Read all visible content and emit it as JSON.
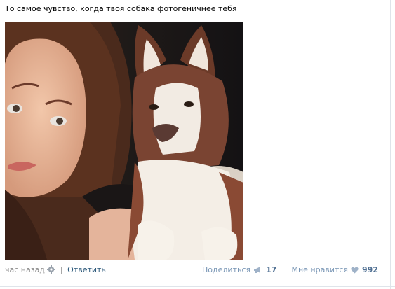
{
  "post": {
    "text": "То самое чувство, когда твоя собака фотогеничнее тебя"
  },
  "photo": {
    "icon": "dog-selfie-photo"
  },
  "footer": {
    "timestamp": "час назад",
    "reply_label": "Ответить",
    "share_label": "Поделиться",
    "share_count": "17",
    "like_label": "Мне нравится",
    "like_count": "992"
  },
  "colors": {
    "link": "#2b587a",
    "muted": "#8a8a8a",
    "action_blue": "#7996b5",
    "count_blue": "#4f6f92"
  }
}
